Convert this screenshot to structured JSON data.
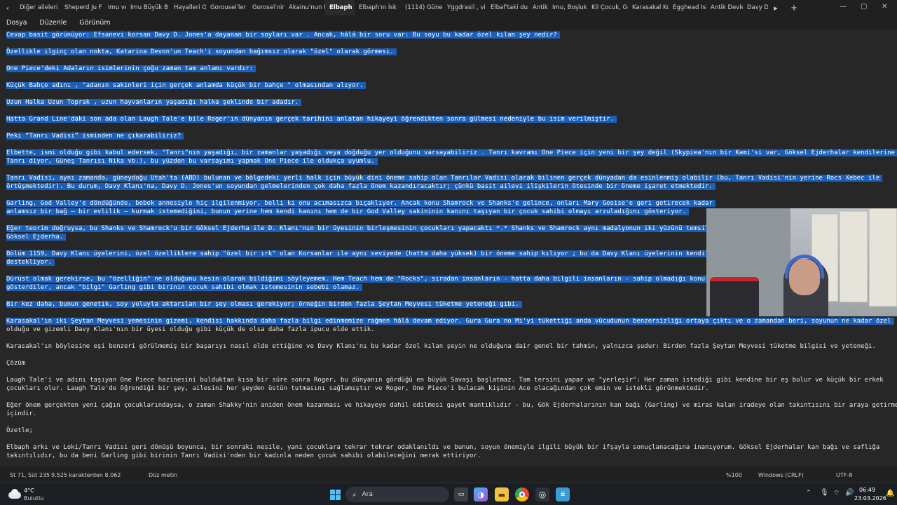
{
  "tabs": [
    "Diğer aileleri",
    "Sheperd Ju F",
    "Imu ve",
    "Imu Büyük B",
    "Hayalleri Olr",
    "Gorousei'ler",
    "Gorosei'nin i",
    "Akainu'nun I",
    "Elbaph",
    "Elbaph'ın İsk",
    "(1114) Güneşi",
    "Yggdrasil , vi",
    "Elbaf'taki du",
    "Antik I",
    "Imu, Boşluk",
    "Kil Çocuk, Ge",
    "Karasakal Ko",
    "Egghead Isla",
    "Antik Devler",
    "Davy D"
  ],
  "active_tab_index": 8,
  "icons": {
    "tab_scroll_left": "chevron-left-icon",
    "tab_scroll_right": "chevron-right-icon",
    "new_tab": "plus-icon",
    "minimize": "minimize-icon",
    "maximize": "maximize-icon",
    "close": "close-icon",
    "heading": "heading-icon",
    "list": "list-icon",
    "bold": "bold-icon",
    "italic": "italic-icon",
    "link": "link-icon",
    "clear_format": "clear-format-icon",
    "copilot": "copilot-icon",
    "account": "account-icon",
    "settings": "gear-icon"
  },
  "menu": {
    "file": "Dosya",
    "edit": "Düzenle",
    "view": "Görünüm"
  },
  "editor_lines": [
    {
      "text": "Cevap basit görünüyor: Efsanevi korsan Davy D. Jones'a dayanan bir soyları var . Ancak, hâlâ bir soru var: Bu soyu bu kadar özel kılan şey nedir?",
      "selected": true
    },
    {
      "text": "Özellikle ilginç olan nokta, Katarina Devon'un Teach'i soyundan bağımsız olarak \"özel\" olarak görmesi.",
      "selected": true
    },
    {
      "text": "One Piece'deki Adaların isimlerinin çoğu zaman tam anlamı vardır:",
      "selected": true
    },
    {
      "text": "Küçük Bahçe adını , \"adanın sakinleri için gerçek anlamda küçük bir bahçe \" olmasından alıyor.",
      "selected": true
    },
    {
      "text": "Uzun Halka Uzun Toprak , uzun hayvanların yaşadığı halka şeklinde bir adadır.",
      "selected": true
    },
    {
      "text": "Hatta Grand Line'daki son ada olan Laugh Tale'e bile Roger'ın dünyanın gerçek tarihini anlatan hikayeyi öğrendikten sonra gülmesi nedeniyle bu isim verilmiştir.",
      "selected": true
    },
    {
      "text": "Peki “Tanrı Vadisi” isminden ne çıkarabiliriz?",
      "selected": true
    },
    {
      "text": "Elbette, ismi olduğu gibi kabul edersek, \"Tanrı\"nın yaşadığı, bir zamanlar yaşadığı veya doğduğu yer olduğunu varsayabiliriz . Tanrı kavramı One Piece için yeni bir şey değil (Skypiea'nın bir Kami'si var, Göksel Ejderhalar kendilerine",
      "selected": true
    },
    {
      "text": "Tanrı diyor, Güneş Tanrısı Nika vb.), bu yüzden bu varsayımı yapmak One Piece ile oldukça uyumlu.",
      "selected": true
    },
    {
      "text": "Tanrı Vadisi, aynı zamanda, güneydoğu Utah'ta (ABD) bulunan ve bölgedeki yerli halk için büyük dini öneme sahip olan Tanrılar Vadisi olarak bilinen gerçek dünyadan da esinlenmiş olabilir (bu, Tanrı Vadisi'nin yerine Rocs Xebec ile",
      "selected": true
    },
    {
      "text": "örtüşmektedir). Bu durum, Davy Klanı'na, Davy D. Jones'un soyundan gelmelerinden çok daha fazla önem kazandıracaktır; çünkü basit ailevi ilişkilerin ötesinde bir öneme işaret etmektedir.",
      "selected": true
    },
    {
      "text": "Garling, God Valley'e döndüğünde, bebek annesiyle hiç ilgilenmiyor, belli ki onu acımasızca bıçaklıyor. Ancak konu Shamrock ve Shanks'e gelince, onları Mary Geoise'e geri getirecek kadar",
      "selected": true
    },
    {
      "text": "anlamsız bir bağ – bir evlilik – kurmak istemediğini, bunun yerine hem kendi kanını hem de bir God Valley sakininin kanını taşıyan bir çocuk sahibi olmayı arzuladığını gösteriyor.",
      "selected": true
    },
    {
      "text": "Eğer teorim doğruysa, bu Shanks ve Shamrock'u bir Göksel Ejderha ile D. Klanı'nın bir üyesinin birleşmesinin çocukları yapacaktı *.* Shanks ve Shamrock aynı madalyonun iki yüzünü temsil e",
      "selected": true
    },
    {
      "text": "Göksel Ejderha.",
      "selected": true
    },
    {
      "text": "Bölüm 1159, Davy Klanı üyelerini, özel özelliklere sahip \"özel bir ırk\" olan Korsanlar ile aynı seviyede (hatta daha yüksek) bir öneme sahip kılıyor ; bu da Davy Klanı üyelerinin kendiler",
      "selected": true
    },
    {
      "text": "destekliyor.",
      "selected": true
    },
    {
      "text": "Dürüst olmak gerekirse, bu \"özelliğin\" ne olduğunu kesin olarak bildiğimi söyleyemem. Hem Teach hem de \"Rocks\", sıradan insanların - hatta daha bilgili insanların - sahip olmadığı konular",
      "selected": true
    },
    {
      "text": "gösterdiler, ancak \"bilgi\" Garling gibi birinin çocuk sahibi olmak istemesinin sebebi olamaz.",
      "selected": true
    },
    {
      "text": "Bir kez daha, bunun genetik, soy yoluyla aktarılan bir şey olması gerekiyor; örneğin birden fazla Şeytan Meyvesi tüketme yeteneği gibi.",
      "selected": true
    },
    {
      "text": "Karasakal'ın iki Şeytan Meyvesi yemesinin gizemi, kendisi hakkında daha fazla bilgi edinmemize rağmen hâlâ devam ediyor. Gura Gura no Mi'yi tükettiği anda vücudunun benzersizliği ortaya çıktı ve o zamandan beri, soyunun ne kadar özel",
      "selected": true
    },
    {
      "text": "olduğu ve gizemli Davy Klanı'nın bir üyesi olduğu gibi küçük de olsa daha fazla ipucu elde ettik.",
      "selected": false
    },
    {
      "text": "Karasakal'ın böylesine eşi benzeri görülmemiş bir başarıyı nasıl elde ettiğine ve Davy Klanı'nı bu kadar özel kılan şeyin ne olduğuna dair genel bir tahmin, yalnızca şudur: Birden fazla Şeytan Meyvesi tüketme bilgisi ve yeteneği.",
      "selected": false
    },
    {
      "text": "Çözüm",
      "selected": false
    },
    {
      "text": "Laugh Tale'i ve adını taşıyan One Piece hazinesini bulduktan kısa bir süre sonra Roger, bu dünyanın gördüğü en büyük Savaşı başlatmaz. Tam tersini yapar ve \"yerleşir\": Her zaman istediği gibi kendine bir eş bulur ve küçük bir erkek",
      "selected": false
    },
    {
      "text": "çocukları olur. Laugh Tale'de öğrendiği bir şey, ailesini her şeyden üstün tutmasını sağlamıştır ve Roger, One Piece'i bulacak kişinin Ace olacağından çok emin ve istekli görünmektedir.",
      "selected": false
    },
    {
      "text": "Eğer önem gerçekten yeni çağın çocuklarındaysa, o zaman Shakky'nin aniden önem kazanması ve hikayeye dahil edilmesi gayet mantıklıdır - bu, Gök Ejderhalarının kan bağı (Garling) ve miras kalan iradeye olan takıntısını bir araya getirmek",
      "selected": false
    },
    {
      "text": "içindir.",
      "selected": false
    },
    {
      "text": "Özetle;",
      "selected": false
    },
    {
      "text": "Elbaph arkı ve Loki/Tanrı Vadisi geri dönüşü boyunca, bir sonraki nesile, yani çocuklara tekrar tekrar odaklanıldı ve bunun, soyun önemiyle ilgili büyük bir ifşayla sonuçlanacağına inanıyorum. Göksel Ejderhalar kan bağı ve saflığa",
      "selected": false
    },
    {
      "text": "takıntılıdır, bu da beni Garling gibi birinin Tanrı Vadisi'nden bir kadınla neden çocuk sahibi olabileceğini merak ettiriyor.",
      "selected": false
    }
  ],
  "status": {
    "position": "St 71, Süt 235",
    "count": "9.525 karakterden 8.062",
    "format": "Düz metin",
    "zoom": "%100",
    "eol": "Windows (CRLF)",
    "encoding": "UTF-8"
  },
  "taskbar": {
    "temperature": "4°C",
    "weather": "Bulutlu",
    "search_placeholder": "Ara",
    "time": "06:49",
    "date": "23.03.2026"
  }
}
